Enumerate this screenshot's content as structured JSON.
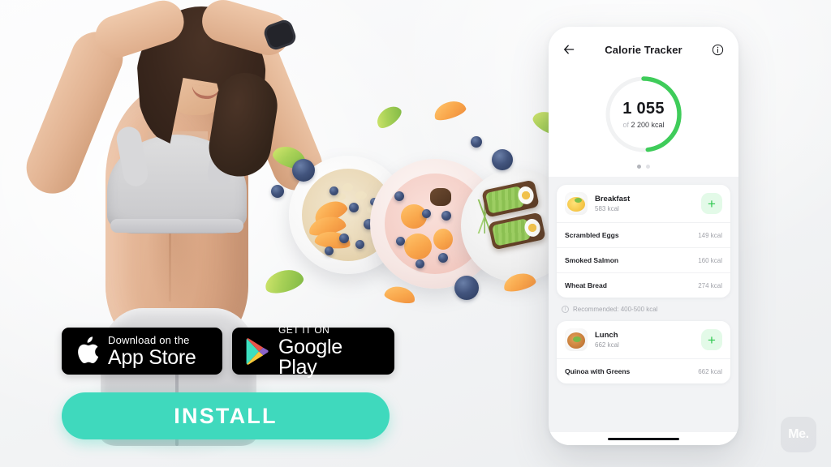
{
  "brand": {
    "watermark": "Me.",
    "accent_teal": "#3FD9BD",
    "accent_green": "#2EC84F",
    "badge_black": "#000000"
  },
  "cta": {
    "install_label": "INSTALL",
    "app_store": {
      "small": "Download on the",
      "big": "App Store",
      "icon": "apple-icon"
    },
    "google_play": {
      "small": "GET IT ON",
      "big": "Google Play",
      "icon": "google-play-icon"
    }
  },
  "phone": {
    "header": {
      "back_icon": "arrow-left-icon",
      "title": "Calorie Tracker",
      "info_icon": "info-icon"
    },
    "ring": {
      "value": "1 055",
      "of_label": "of",
      "goal": "2 200 kcal",
      "percent": 48,
      "track_color": "#F1F2F3",
      "progress_color": "#3FCC5A"
    },
    "pager": {
      "count": 2,
      "active": 0
    },
    "recommended": {
      "icon": "info-icon",
      "text": "Recommended: 400-500 kcal"
    },
    "meals": [
      {
        "name": "Breakfast",
        "kcal": "583 kcal",
        "thumb": "scrambled-eggs-thumb",
        "add_label": "+",
        "items": [
          {
            "name": "Scrambled Eggs",
            "kcal": "149 kcal"
          },
          {
            "name": "Smoked Salmon",
            "kcal": "160 kcal"
          },
          {
            "name": "Wheat Bread",
            "kcal": "274 kcal"
          }
        ]
      },
      {
        "name": "Lunch",
        "kcal": "662 kcal",
        "thumb": "quinoa-thumb",
        "add_label": "+",
        "items": [
          {
            "name": "Quinoa with Greens",
            "kcal": "662 kcal"
          }
        ]
      }
    ]
  }
}
